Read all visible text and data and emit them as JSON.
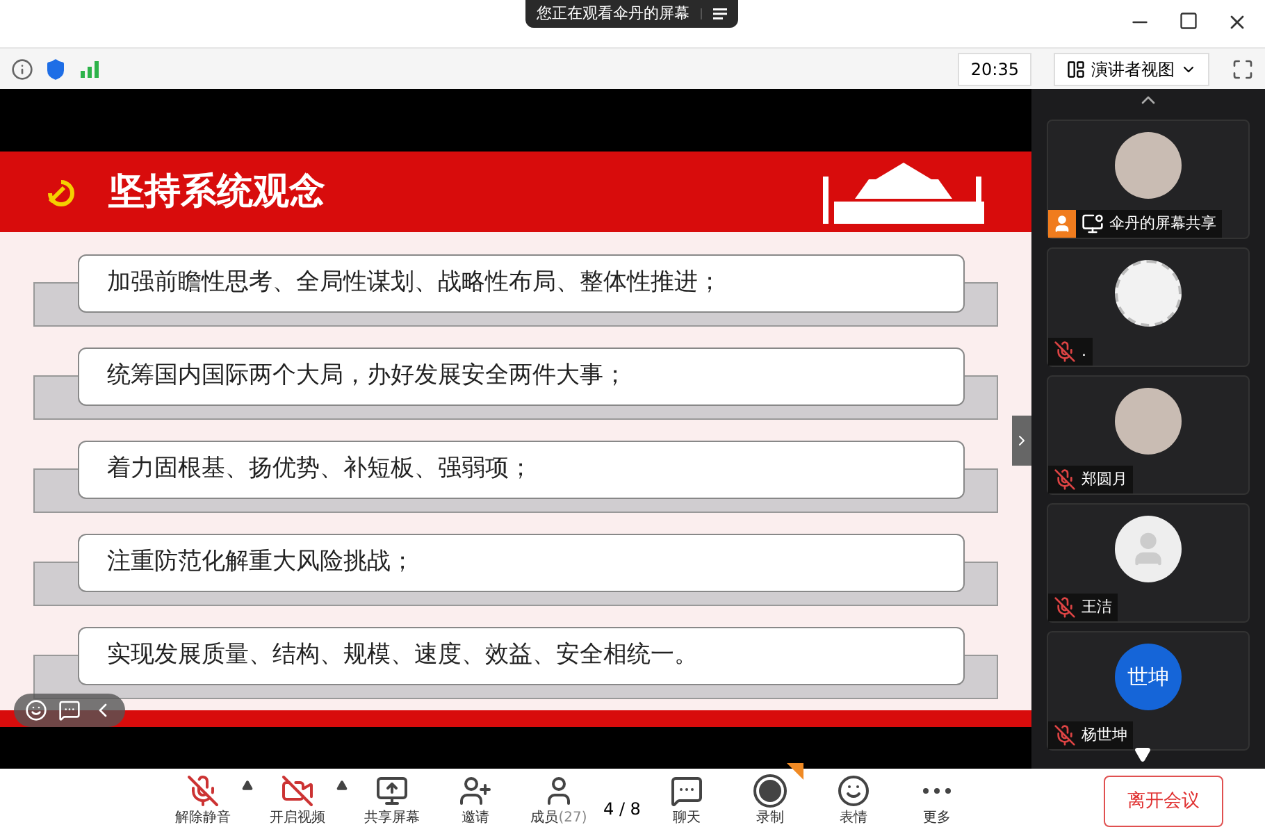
{
  "banner": {
    "text": "您正在观看伞丹的屏幕"
  },
  "info_bar": {
    "time": "20:35",
    "view_button": "演讲者视图"
  },
  "slide": {
    "title": "坚持系统观念",
    "items": [
      "加强前瞻性思考、全局性谋划、战略性布局、整体性推进；",
      "统筹国内国际两个大局，办好发展安全两件大事；",
      "着力固根基、扬优势、补短板、强弱项；",
      "注重防范化解重大风险挑战；",
      "实现发展质量、结构、规模、速度、效益、安全相统一。"
    ],
    "page": "4 / 8"
  },
  "participants": [
    {
      "name": "伞丹的屏幕共享",
      "kind": "photo",
      "sharing": true
    },
    {
      "name": ".",
      "kind": "blank",
      "sharing": false
    },
    {
      "name": "郑圆月",
      "kind": "photo",
      "sharing": false
    },
    {
      "name": "王洁",
      "kind": "silhouette",
      "sharing": false
    },
    {
      "name": "杨世坤",
      "kind": "initials",
      "initials": "世坤",
      "sharing": false
    }
  ],
  "toolbar": [
    {
      "label": "解除静音",
      "kind": "mic",
      "menu": true
    },
    {
      "label": "开启视频",
      "kind": "video",
      "menu": true
    },
    {
      "label": "共享屏幕",
      "kind": "share",
      "menu": false
    },
    {
      "label": "邀请",
      "kind": "invite",
      "menu": false
    },
    {
      "label": "成员",
      "count": "(27)",
      "kind": "members",
      "menu": false
    },
    {
      "label": "聊天",
      "kind": "chat",
      "menu": false
    },
    {
      "label": "录制",
      "kind": "record",
      "menu": false
    },
    {
      "label": "表情",
      "kind": "emoji",
      "menu": false
    },
    {
      "label": "更多",
      "kind": "more",
      "menu": false
    }
  ],
  "leave_button": "离开会议"
}
